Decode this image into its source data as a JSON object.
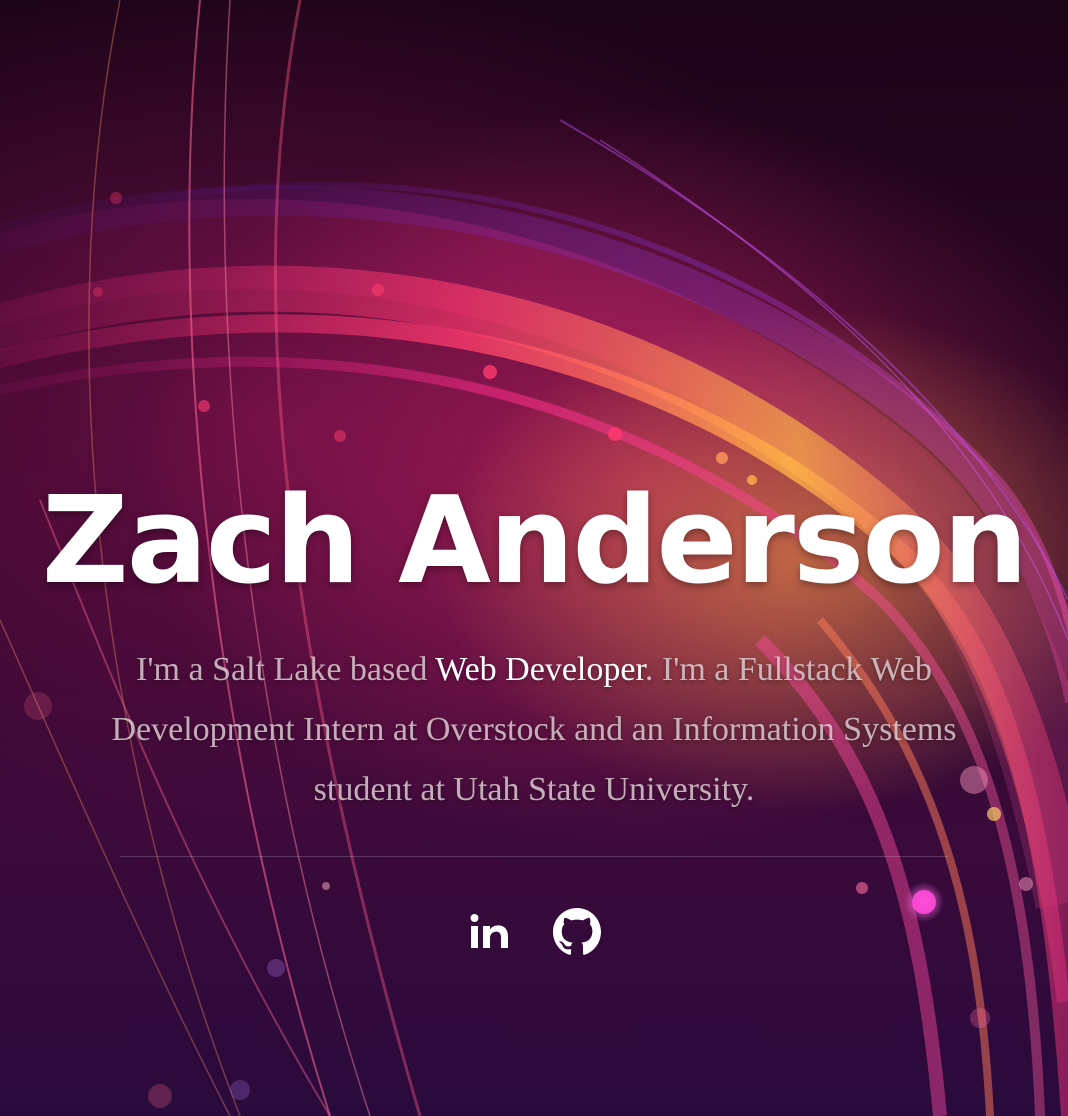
{
  "hero": {
    "name": "Zach Anderson",
    "bio_prefix": "I'm a Salt Lake based ",
    "bio_highlight": "Web Developer",
    "bio_suffix": ". I'm a Fullstack Web Development Intern at Overstock and an Information Systems student at Utah State University."
  },
  "socials": [
    {
      "icon": "linkedin-icon",
      "label": "LinkedIn"
    },
    {
      "icon": "github-icon",
      "label": "GitHub"
    }
  ],
  "colors": {
    "text_primary": "#ffffff",
    "text_muted": "#e1d2d7",
    "background_dark": "#1a0418",
    "accent_pink": "#e6286e",
    "accent_orange": "#ffaa46",
    "accent_purple": "#7a2ad8"
  }
}
